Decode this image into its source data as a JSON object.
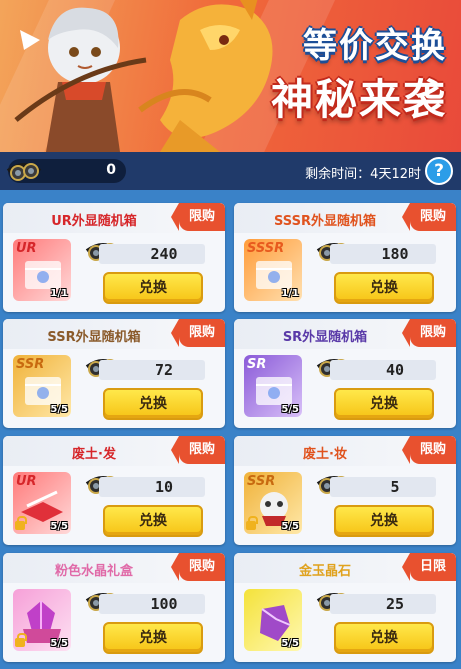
{
  "banner": {
    "title_line1": "等价交换",
    "title_line2": "神秘来袭"
  },
  "topbar": {
    "currency_amount": "0",
    "remaining_label": "剩余时间：",
    "remaining_value": "4天12时",
    "help_label": "?",
    "currency_icon": "gear-goggles-icon"
  },
  "colors": {
    "ur": "#d6262a",
    "sssr": "#e0531e",
    "ssr": "#7a4f20",
    "sr": "#5a3aa8",
    "tag": "#e8512f"
  },
  "items": [
    {
      "name": "UR外显随机箱",
      "tag": "限购",
      "rarity": "UR",
      "price": "240",
      "count": "1/1",
      "button": "兑换",
      "locked": false,
      "name_color": "#d6262a"
    },
    {
      "name": "SSSR外显随机箱",
      "tag": "限购",
      "rarity": "SSSR",
      "price": "180",
      "count": "1/1",
      "button": "兑换",
      "locked": false,
      "name_color": "#e0531e"
    },
    {
      "name": "SSR外显随机箱",
      "tag": "限购",
      "rarity": "SSR",
      "price": "72",
      "count": "5/5",
      "button": "兑换",
      "locked": false,
      "name_color": "#8a5a2a"
    },
    {
      "name": "SR外显随机箱",
      "tag": "限购",
      "rarity": "SR",
      "price": "40",
      "count": "5/5",
      "button": "兑换",
      "locked": false,
      "name_color": "#5a3aa8"
    },
    {
      "name": "废土·发",
      "tag": "限购",
      "rarity": "UR",
      "price": "10",
      "count": "5/5",
      "button": "兑换",
      "locked": true,
      "name_color": "#d6262a"
    },
    {
      "name": "废土·妆",
      "tag": "限购",
      "rarity": "SSR",
      "price": "5",
      "count": "5/5",
      "button": "兑换",
      "locked": true,
      "name_color": "#e0531e"
    },
    {
      "name": "粉色水晶礼盒",
      "tag": "限购",
      "rarity": "",
      "price": "100",
      "count": "5/5",
      "button": "兑换",
      "locked": true,
      "name_color": "#e06aa8"
    },
    {
      "name": "金玉晶石",
      "tag": "日限",
      "rarity": "",
      "price": "25",
      "count": "5/5",
      "button": "兑换",
      "locked": false,
      "name_color": "#e0a21e"
    }
  ]
}
